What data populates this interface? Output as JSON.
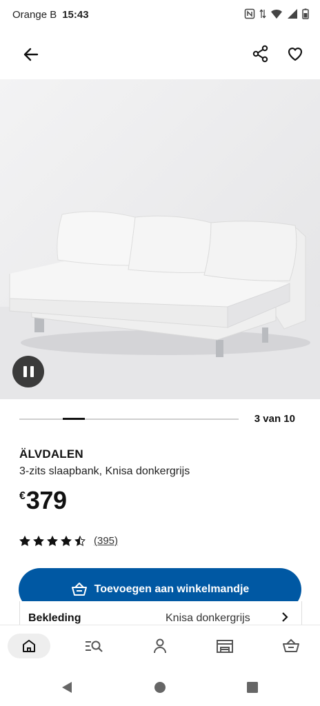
{
  "status": {
    "carrier": "Orange B",
    "time": "15:43"
  },
  "topbar": {
    "back_icon": "arrow-left-icon",
    "share_icon": "share-icon",
    "favorite_icon": "heart-icon"
  },
  "gallery": {
    "counter": "3 van 10",
    "current_index": 3,
    "total": 10
  },
  "product": {
    "name": "ÄLVDALEN",
    "description": "3-zits slaapbank, Knisa donkergrijs",
    "currency": "€",
    "price": "379",
    "rating": 4.5,
    "review_count": "(395)"
  },
  "cart": {
    "label": "Toevoegen aan winkelmandje"
  },
  "option": {
    "label": "Bekleding",
    "value": "Knisa donkergrijs"
  },
  "bottom_nav": [
    "home-icon",
    "search-list-icon",
    "profile-icon",
    "store-icon",
    "basket-icon"
  ],
  "colors": {
    "accent": "#0058a3",
    "text": "#111111",
    "hero_bg": "#e9e9ea"
  }
}
